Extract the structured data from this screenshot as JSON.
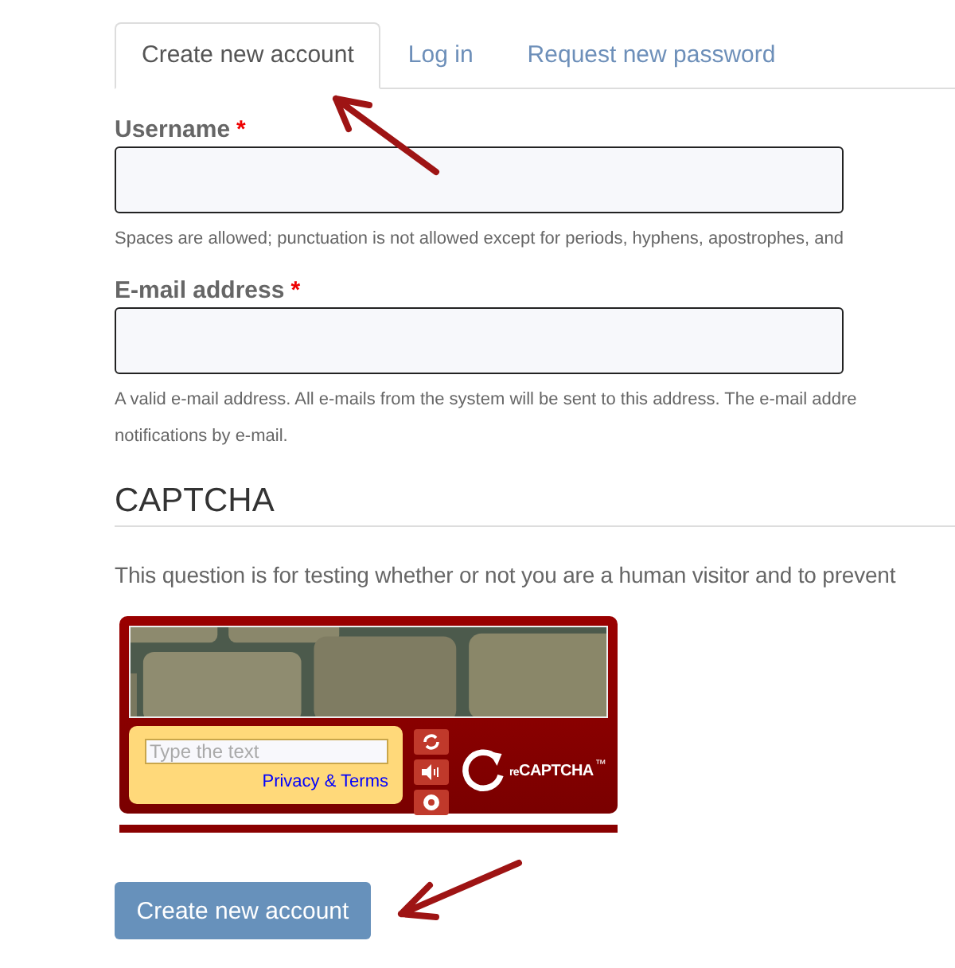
{
  "tabs": [
    {
      "label": "Create new account",
      "selected": true
    },
    {
      "label": "Log in",
      "selected": false
    },
    {
      "label": "Request new password",
      "selected": false
    }
  ],
  "fields": [
    {
      "label": "Username",
      "required": true,
      "required_mark": "*",
      "help": [
        "Spaces are allowed; punctuation is not allowed except for periods, hyphens, apostrophes, and"
      ]
    },
    {
      "label": "E-mail address",
      "required": true,
      "required_mark": "*",
      "help": [
        "A valid e-mail address. All e-mails from the system will be sent to this address. The e-mail addre",
        "notifications by e-mail."
      ]
    }
  ],
  "captcha": {
    "heading": "CAPTCHA",
    "description": "This question is for testing whether or not you are a human visitor and to prevent",
    "widget": {
      "placeholder": "Type the text",
      "link": "Privacy & Terms",
      "logo_prefix": "re",
      "logo_name": "CAPTCHA",
      "logo_mark": "™"
    }
  },
  "submit": "Create new account"
}
